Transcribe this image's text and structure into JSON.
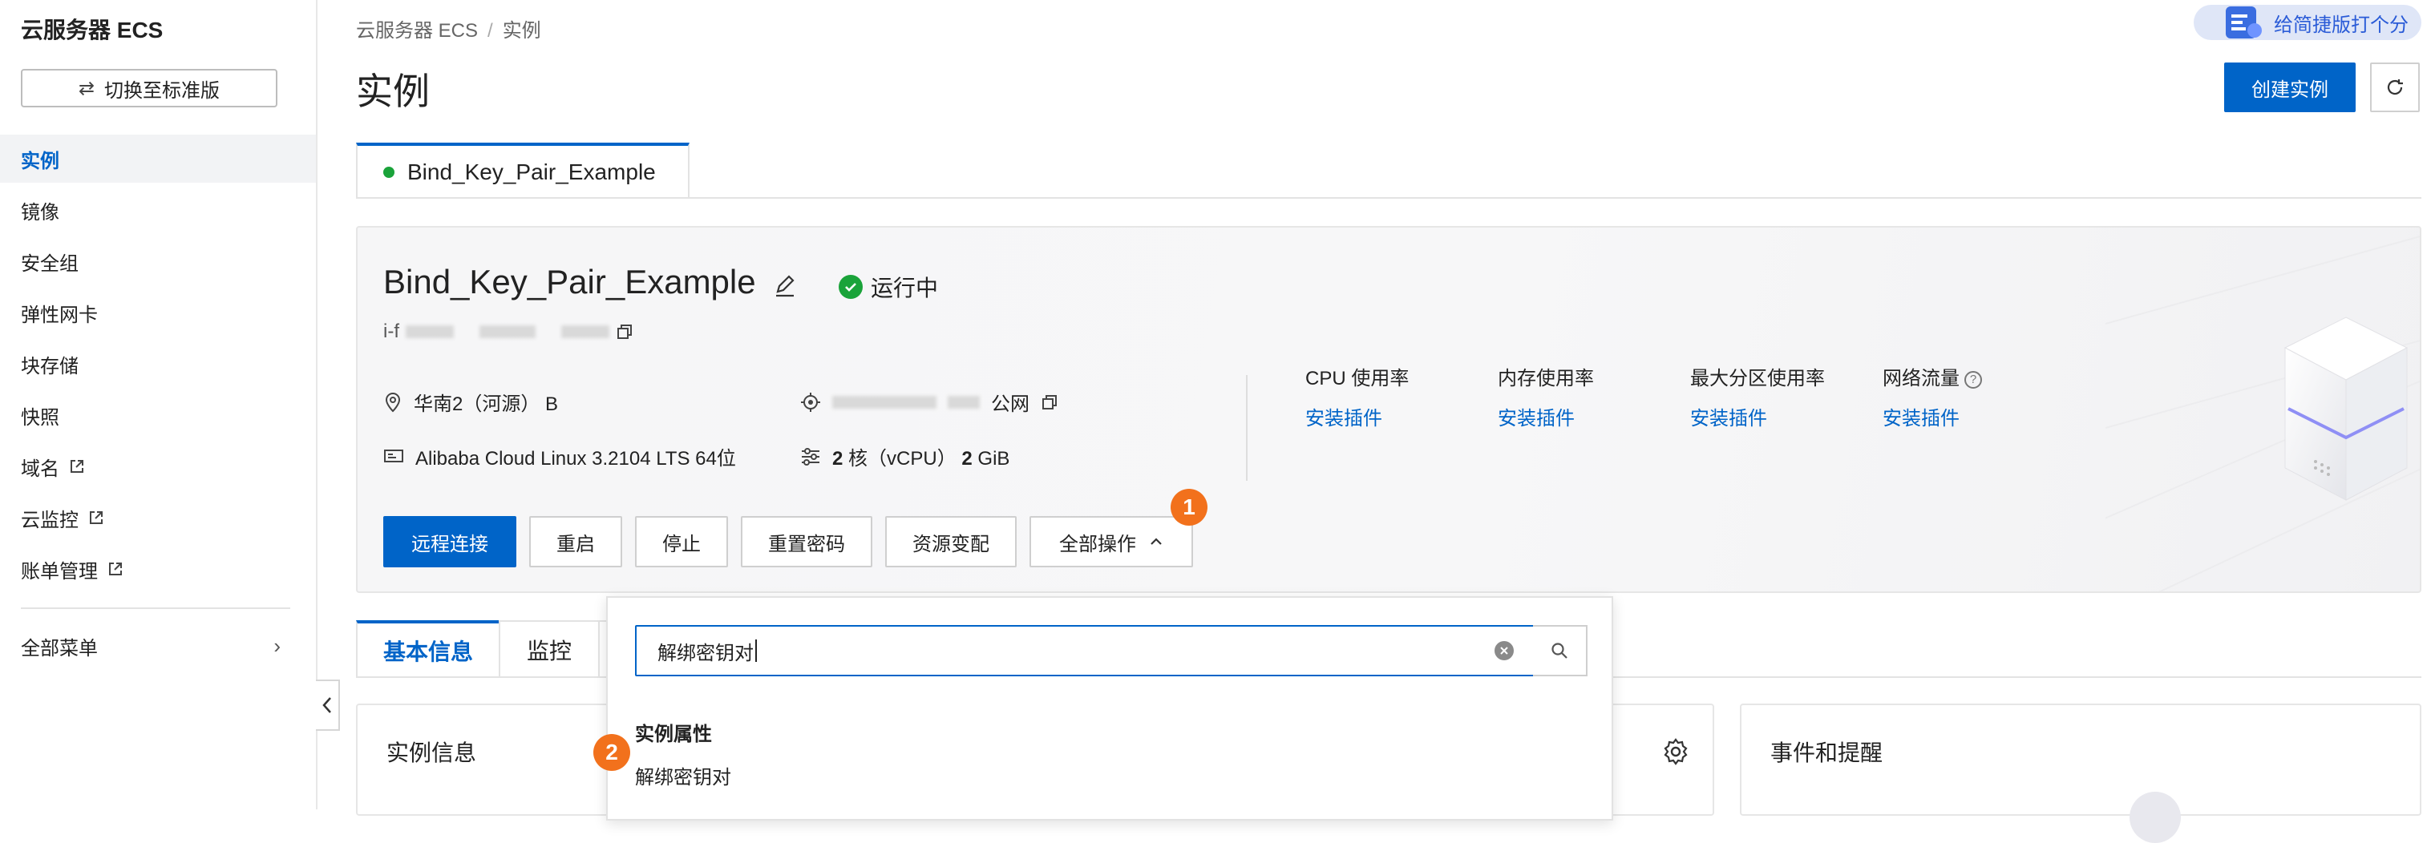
{
  "sidebar": {
    "title": "云服务器 ECS",
    "switch_label": "切换至标准版",
    "items": [
      {
        "label": "实例",
        "active": true
      },
      {
        "label": "镜像"
      },
      {
        "label": "安全组"
      },
      {
        "label": "弹性网卡"
      },
      {
        "label": "块存储"
      },
      {
        "label": "快照"
      },
      {
        "label": "域名",
        "external": true
      },
      {
        "label": "云监控",
        "external": true
      },
      {
        "label": "账单管理",
        "external": true
      }
    ],
    "all_menu": "全部菜单"
  },
  "header": {
    "breadcrumb": [
      "云服务器 ECS",
      "实例"
    ],
    "title": "实例",
    "feedback": "给简捷版打个分",
    "create_button": "创建实例"
  },
  "instance_tab": "Bind_Key_Pair_Example",
  "card": {
    "name": "Bind_Key_Pair_Example",
    "status": "运行中",
    "id_prefix": "i-f",
    "region": "华南2（河源） B",
    "ip_suffix": "公网",
    "os": "Alibaba Cloud Linux 3.2104 LTS 64位",
    "spec_cores": "2",
    "spec_core_unit": "核（vCPU）",
    "spec_mem": "2",
    "spec_mem_unit": "GiB",
    "metrics": [
      {
        "label": "CPU 使用率",
        "link": "安装插件"
      },
      {
        "label": "内存使用率",
        "link": "安装插件"
      },
      {
        "label": "最大分区使用率",
        "link": "安装插件"
      },
      {
        "label": "网络流量",
        "link": "安装插件",
        "help": "?"
      }
    ],
    "buttons": {
      "remote": "远程连接",
      "restart": "重启",
      "stop": "停止",
      "reset_pwd": "重置密码",
      "resize": "资源变配",
      "all_ops": "全部操作"
    }
  },
  "badges": {
    "one": "1",
    "two": "2"
  },
  "sub_tabs": [
    "基本信息",
    "监控"
  ],
  "panels": {
    "instance_info": "实例信息",
    "events": "事件和提醒"
  },
  "dropdown": {
    "search_value": "解绑密钥对",
    "group_label": "实例属性",
    "option": "解绑密钥对"
  },
  "colors": {
    "primary": "#0064c8",
    "success": "#1aa33a",
    "badge": "#f2711c"
  }
}
